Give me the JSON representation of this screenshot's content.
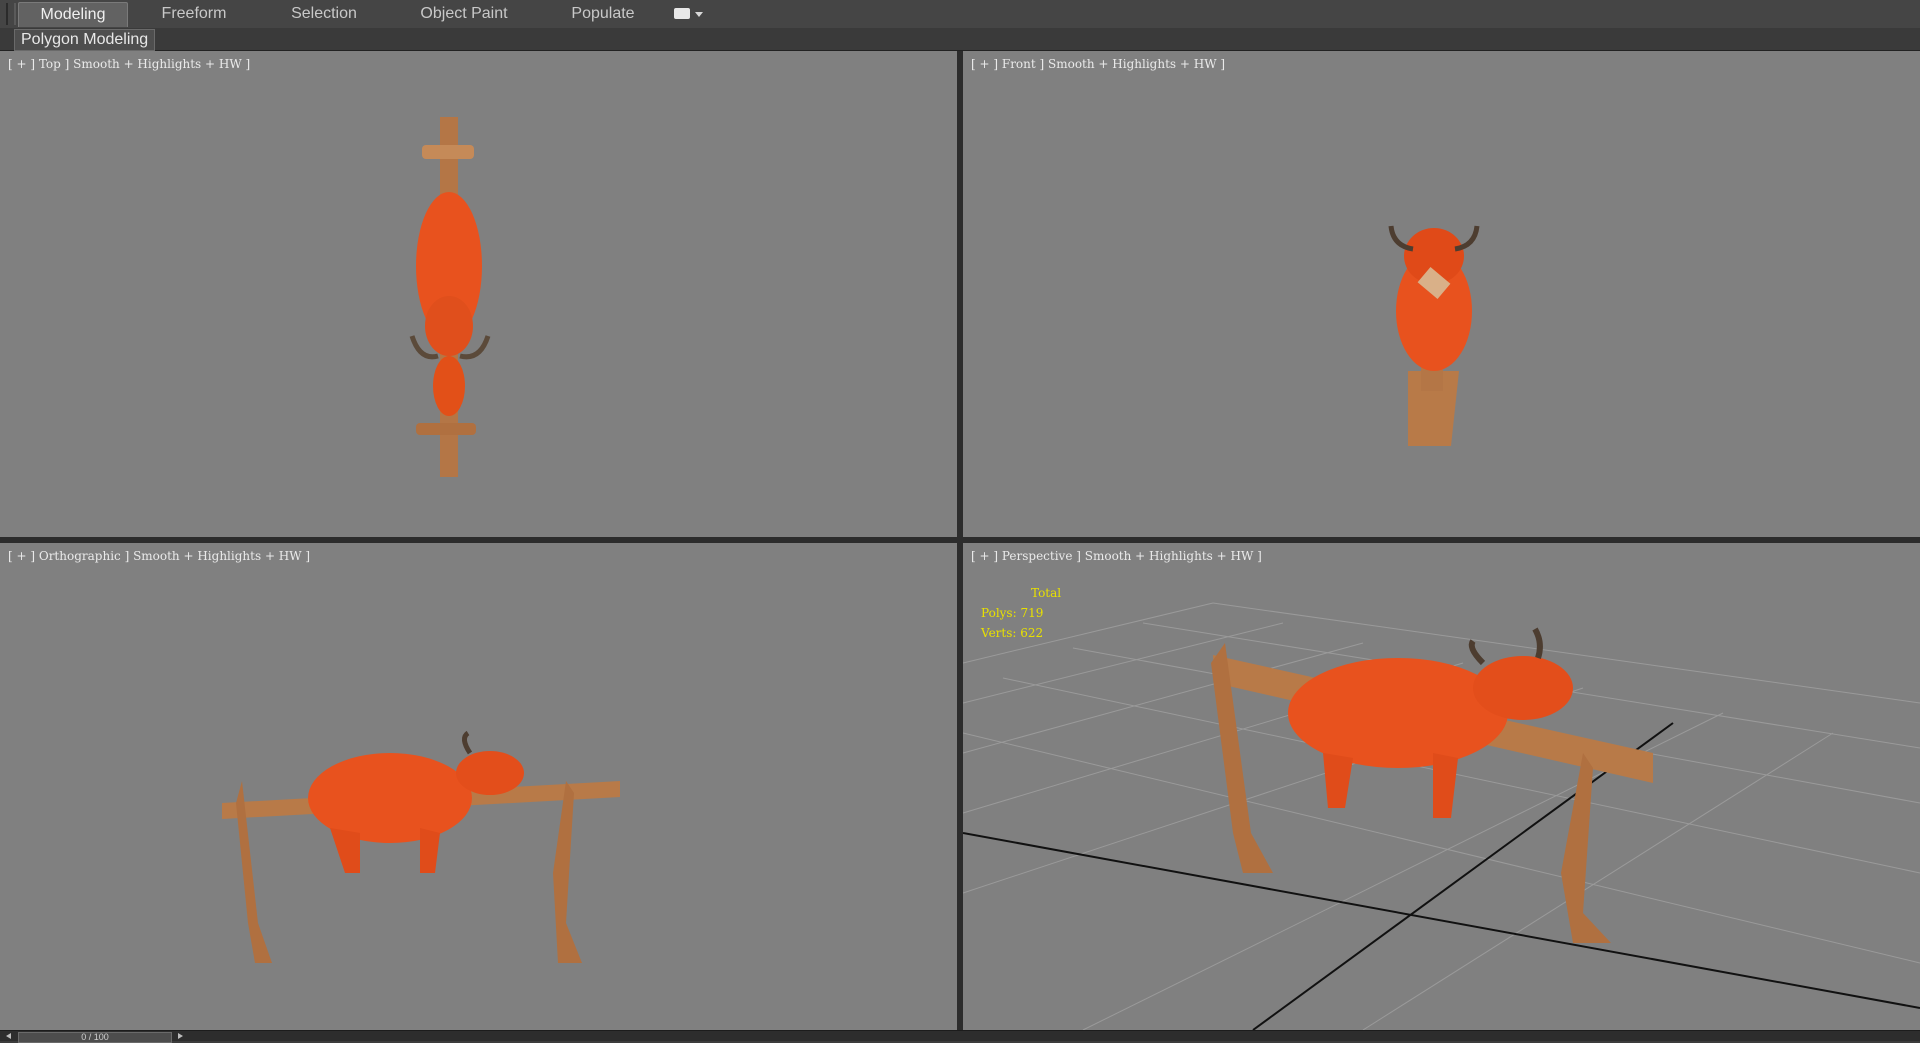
{
  "ribbon": {
    "tabs": [
      "Modeling",
      "Freeform",
      "Selection",
      "Object Paint",
      "Populate"
    ],
    "active_tab": "Modeling",
    "panel_label": "Polygon Modeling"
  },
  "viewports": {
    "top": {
      "label": "[ + ] Top ] Smooth + Highlights + HW ]"
    },
    "front": {
      "label": "[ + ] Front ] Smooth + Highlights + HW ]"
    },
    "ortho": {
      "label": "[ + ] Orthographic ] Smooth + Highlights + HW ]"
    },
    "persp": {
      "label": "[ + ] Perspective ] Smooth + Highlights + HW ]",
      "stats": {
        "total": "Total",
        "polys": "Polys: 719",
        "verts": "Verts: 622"
      }
    }
  },
  "timeline": {
    "slider_label": "0 / 100"
  },
  "colors": {
    "viewport_bg": "#808080",
    "bull": "#e8521e",
    "wood": "#b87a48",
    "stats_text": "#e8e000"
  }
}
